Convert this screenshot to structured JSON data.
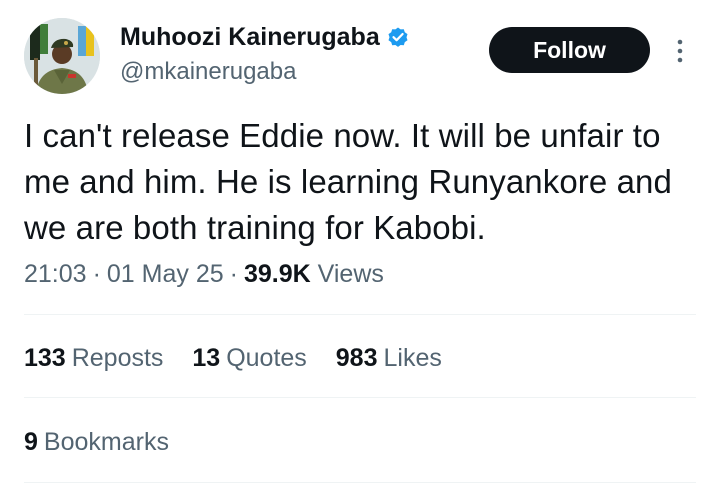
{
  "author": {
    "display_name": "Muhoozi Kainerugaba",
    "handle": "@mkainerugaba",
    "verified": true
  },
  "actions": {
    "follow_label": "Follow"
  },
  "tweet": {
    "lines": [
      "I can't release Eddie now. It will be unfair to",
      "me and him. He is learning Runyankore and",
      "we are both training for Kabobi."
    ],
    "time": "21:03",
    "date": "01 May 25",
    "views_count": "39.9K",
    "views_label": "Views",
    "separator": "·"
  },
  "stats": {
    "reposts_count": "133",
    "reposts_label": "Reposts",
    "quotes_count": "13",
    "quotes_label": "Quotes",
    "likes_count": "983",
    "likes_label": "Likes",
    "bookmarks_count": "9",
    "bookmarks_label": "Bookmarks"
  },
  "colors": {
    "text_primary": "#0f1419",
    "text_secondary": "#536471",
    "verified_blue": "#1d9bf0",
    "divider": "#eff3f4"
  },
  "icons": {
    "verified": "verified-badge-icon",
    "more": "more-options-icon"
  }
}
